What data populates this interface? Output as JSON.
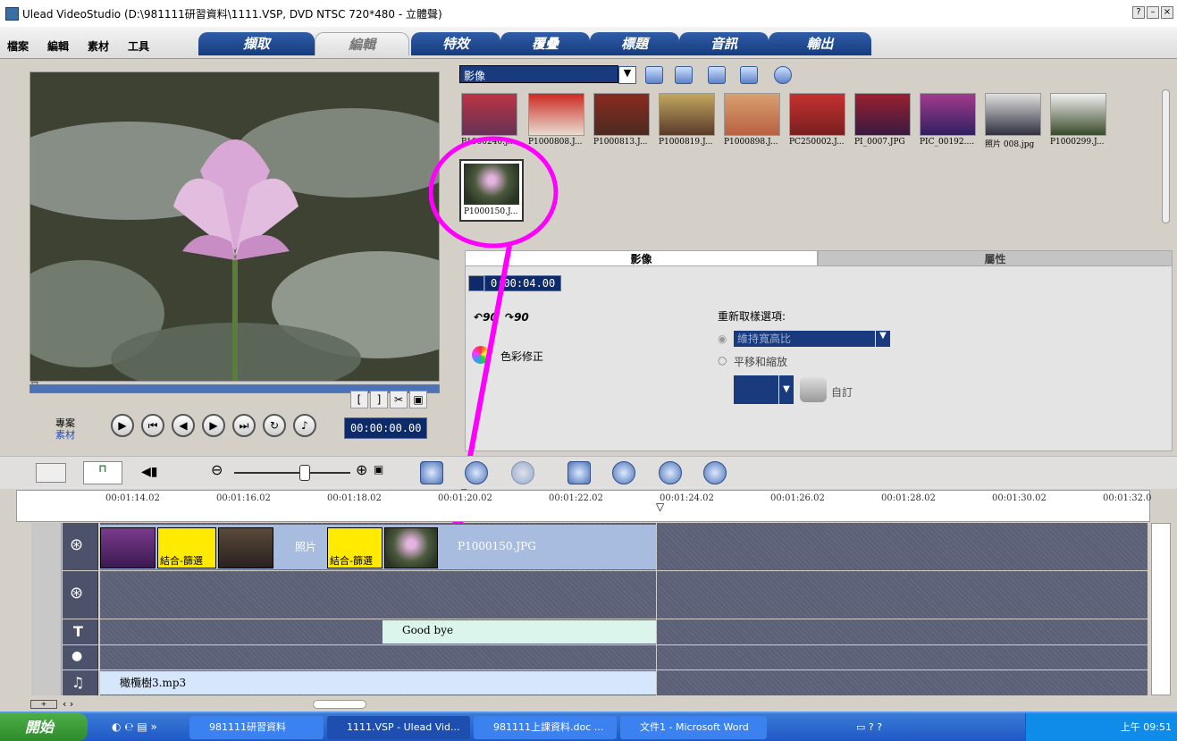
{
  "window": {
    "title": "Ulead VideoStudio (D:\\981111研習資料\\1111.VSP, DVD NTSC 720*480 - 立體聲)"
  },
  "menu": [
    "檔案",
    "編輯",
    "素材",
    "工具"
  ],
  "tabs": [
    "擷取",
    "編輯",
    "特效",
    "覆疊",
    "標題",
    "音訊",
    "輸出"
  ],
  "active_tab": "編輯",
  "preview": {
    "timecode": "00:00:00.00",
    "mode_project": "專案",
    "mode_clip": "素材"
  },
  "library": {
    "dropdown": "影像",
    "thumbs": [
      "P1000240.J...",
      "P1000808.J...",
      "P1000813.J...",
      "P1000819.J...",
      "P1000898.J...",
      "PC250002.J...",
      "PI_0007.JPG",
      "PIC_00192....",
      "照片 008.jpg",
      "P1000299.J..."
    ],
    "selected": "P1000150.J..."
  },
  "options": {
    "tab_image": "影像",
    "tab_attr": "屬性",
    "duration": "0:00:04.00",
    "rot_left": "90",
    "rot_right": "90",
    "color_correct": "色彩修正",
    "resample_label": "重新取樣選項:",
    "opt_keep_ratio": "維持寬高比",
    "opt_pan_zoom": "平移和縮放",
    "custom": "自訂"
  },
  "ruler": [
    "00:01:14.02",
    "00:01:16.02",
    "00:01:18.02",
    "00:01:20.02",
    "00:01:22.02",
    "00:01:24.02",
    "00:01:26.02",
    "00:01:28.02",
    "00:01:30.02",
    "00:01:32.0"
  ],
  "timeline": {
    "clip_photo_label": "照片",
    "clip_transition": "結合-篩選",
    "clip_selected": "P1000150.JPG",
    "title_clip": "Good bye",
    "music_clip": "橄欖樹3.mp3"
  },
  "taskbar": {
    "start": "開始",
    "items": [
      "981111研習資料",
      "1111.VSP - Ulead Vid...",
      "981111上課資料.doc ...",
      "文件1 - Microsoft Word"
    ],
    "clock": "上午 09:51"
  }
}
